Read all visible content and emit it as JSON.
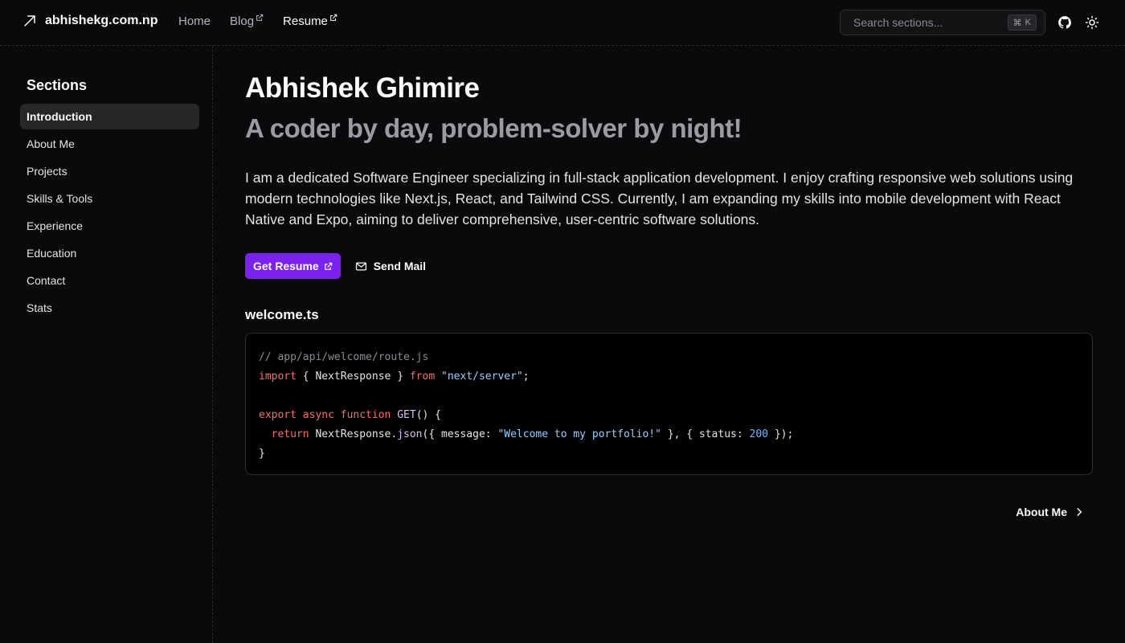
{
  "header": {
    "brand": "abhishekg.com.np",
    "nav": [
      {
        "label": "Home",
        "external": false
      },
      {
        "label": "Blog",
        "external": true
      },
      {
        "label": "Resume",
        "external": true
      }
    ],
    "search_placeholder": "Search sections...",
    "search_shortcut_key": "K"
  },
  "sidebar": {
    "title": "Sections",
    "items": [
      {
        "label": "Introduction",
        "active": true
      },
      {
        "label": "About Me"
      },
      {
        "label": "Projects"
      },
      {
        "label": "Skills & Tools"
      },
      {
        "label": "Experience"
      },
      {
        "label": "Education"
      },
      {
        "label": "Contact"
      },
      {
        "label": "Stats"
      }
    ]
  },
  "main": {
    "name": "Abhishek Ghimire",
    "tagline": "A coder by day, problem-solver by night!",
    "intro": "I am a dedicated Software Engineer specializing in full-stack application development. I enjoy crafting responsive web solutions using modern technologies like Next.js, React, and Tailwind CSS. Currently, I am expanding my skills into mobile development with React Native and Expo, aiming to deliver comprehensive, user-centric software solutions.",
    "primary_button": "Get Resume",
    "secondary_button": "Send Mail",
    "code_title": "welcome.ts",
    "code": {
      "comment": "// app/api/welcome/route.js",
      "import_kw": "import",
      "import_names": " { NextResponse } ",
      "from_kw": "from",
      "module": "\"next/server\"",
      "export_kw": "export async function",
      "fn_name": "GET",
      "fn_sig": "() {",
      "return_kw": "return",
      "return_obj": "NextResponse.",
      "return_method": "json",
      "return_args_a": "({ message: ",
      "message_str": "\"Welcome to my portfolio!\"",
      "return_args_b": " }, { status: ",
      "status_num": "200",
      "return_args_c": " });",
      "close": "}"
    },
    "next_link": "About Me"
  },
  "colors": {
    "accent": "#7c22f0",
    "background": "#0a0a0c"
  }
}
